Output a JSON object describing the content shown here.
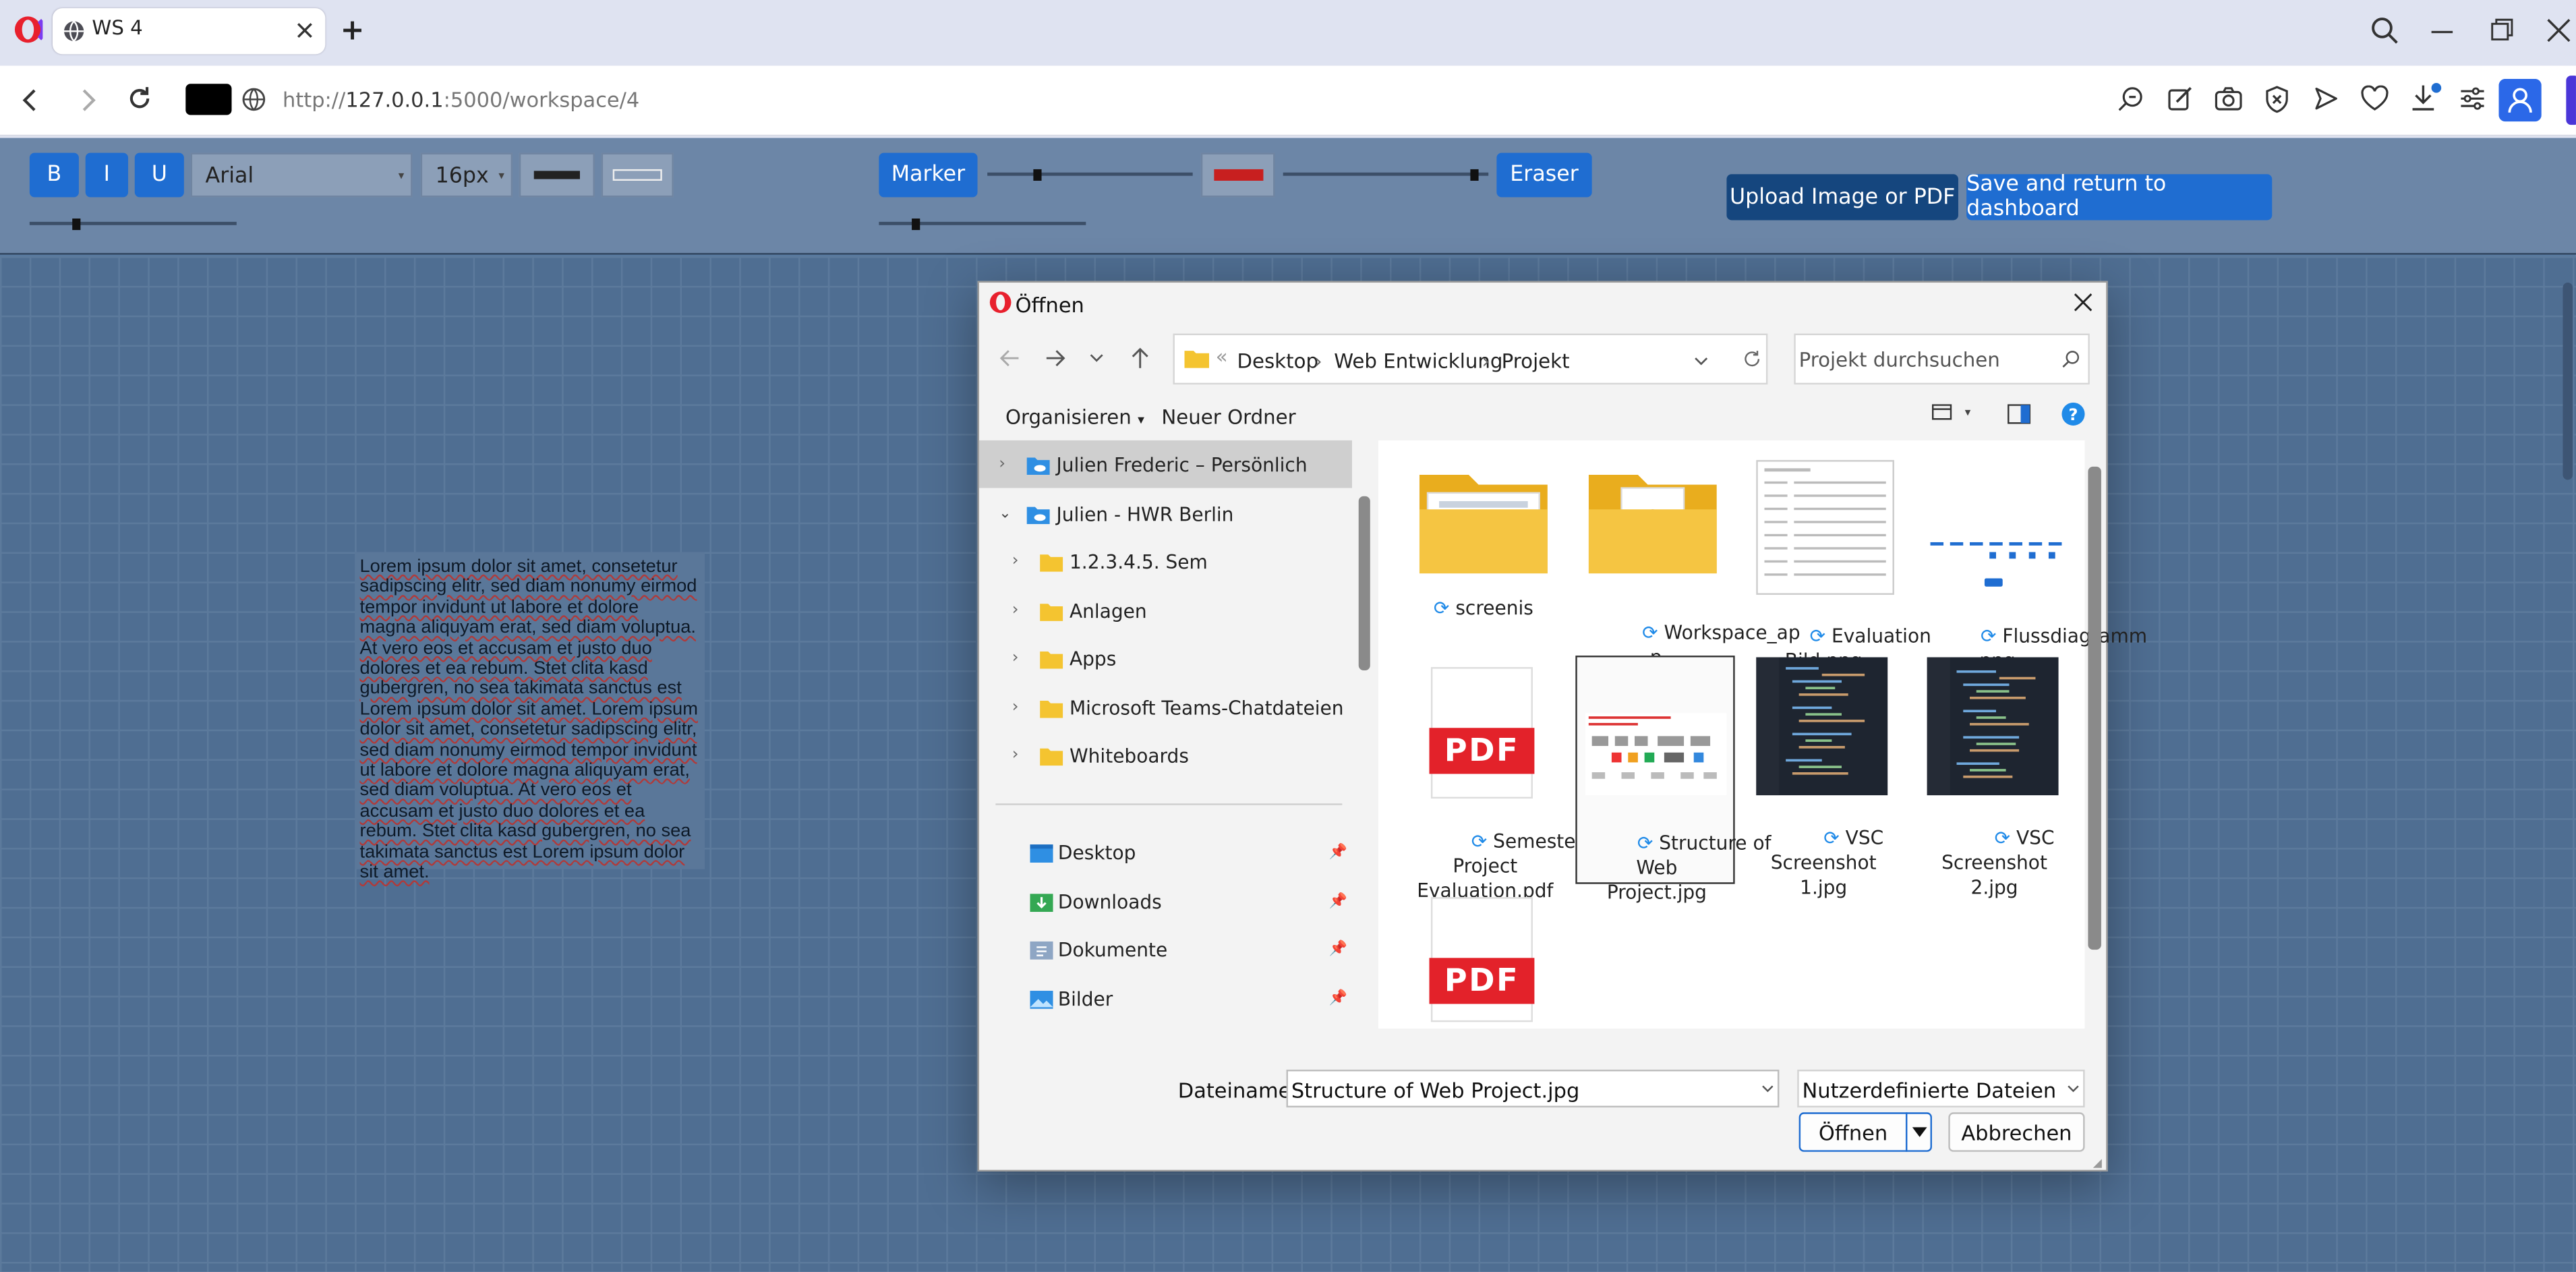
{
  "browser": {
    "tab_title": "WS 4",
    "url_prefix": "http://",
    "url_host": "127.0.0.1",
    "url_rest": ":5000/workspace/4"
  },
  "toolbar": {
    "bold_label": "B",
    "italic_label": "I",
    "underline_label": "U",
    "font_family_value": "Arial",
    "font_size_value": "16px",
    "marker_label": "Marker",
    "eraser_label": "Eraser",
    "upload_label": "Upload Image or PDF",
    "save_label": "Save and return to dashboard",
    "text_color": "#222222",
    "marker_color": "#d11a1a",
    "accent": "#1f6dd1"
  },
  "canvas": {
    "text": "Lorem ipsum dolor sit amet, consetetur sadipscing elitr, sed diam nonumy eirmod tempor invidunt ut labore et dolore magna aliquyam erat, sed diam voluptua. At vero eos et accusam et justo duo dolores et ea rebum. Stet clita kasd gubergren, no sea takimata sanctus est Lorem ipsum dolor sit amet. Lorem ipsum dolor sit amet, consetetur sadipscing elitr, sed diam nonumy eirmod tempor invidunt ut labore et dolore magna aliquyam erat, sed diam voluptua. At vero eos et accusam et justo duo dolores et ea rebum. Stet clita kasd gubergren, no sea takimata sanctus est Lorem ipsum dolor sit amet."
  },
  "dialog": {
    "title": "Öffnen",
    "breadcrumbs": [
      "Desktop",
      "Web Entwicklung",
      "Projekt"
    ],
    "search_placeholder": "Projekt durchsuchen",
    "organize_label": "Organisieren",
    "new_folder_label": "Neuer Ordner",
    "nav": {
      "onedrive_personal": "Julien Frederic – Persönlich",
      "onedrive_business": "Julien - HWR Berlin",
      "folders": [
        "1.2.3.4.5. Sem",
        "Anlagen",
        "Apps",
        "Microsoft Teams-Chatdateien",
        "Whiteboards"
      ],
      "quick": [
        "Desktop",
        "Downloads",
        "Dokumente",
        "Bilder"
      ]
    },
    "files": [
      {
        "name": "screenis",
        "kind": "folder"
      },
      {
        "name": "Workspace_ap\np",
        "kind": "folder"
      },
      {
        "name": "Evaluation\nBild.png",
        "kind": "image-doc"
      },
      {
        "name": "Flussdiagramm\n.png",
        "kind": "image-diagram"
      },
      {
        "name": "Semester\nProject\nEvaluation.pdf",
        "kind": "pdf"
      },
      {
        "name": "Structure of\nWeb\nProject.jpg",
        "kind": "image-doc"
      },
      {
        "name": "VSC\nScreenshot\n1.jpg",
        "kind": "image-code"
      },
      {
        "name": "VSC\nScreenshot\n2.jpg",
        "kind": "image-code"
      },
      {
        "name": "",
        "kind": "pdf"
      }
    ],
    "pdf_badge": "PDF",
    "filename_label": "Dateiname:",
    "filename_value": "Structure of Web Project.jpg",
    "filetype_value": "Nutzerdefinierte Dateien (*.x",
    "open_label": "Öffnen",
    "cancel_label": "Abbrechen"
  }
}
